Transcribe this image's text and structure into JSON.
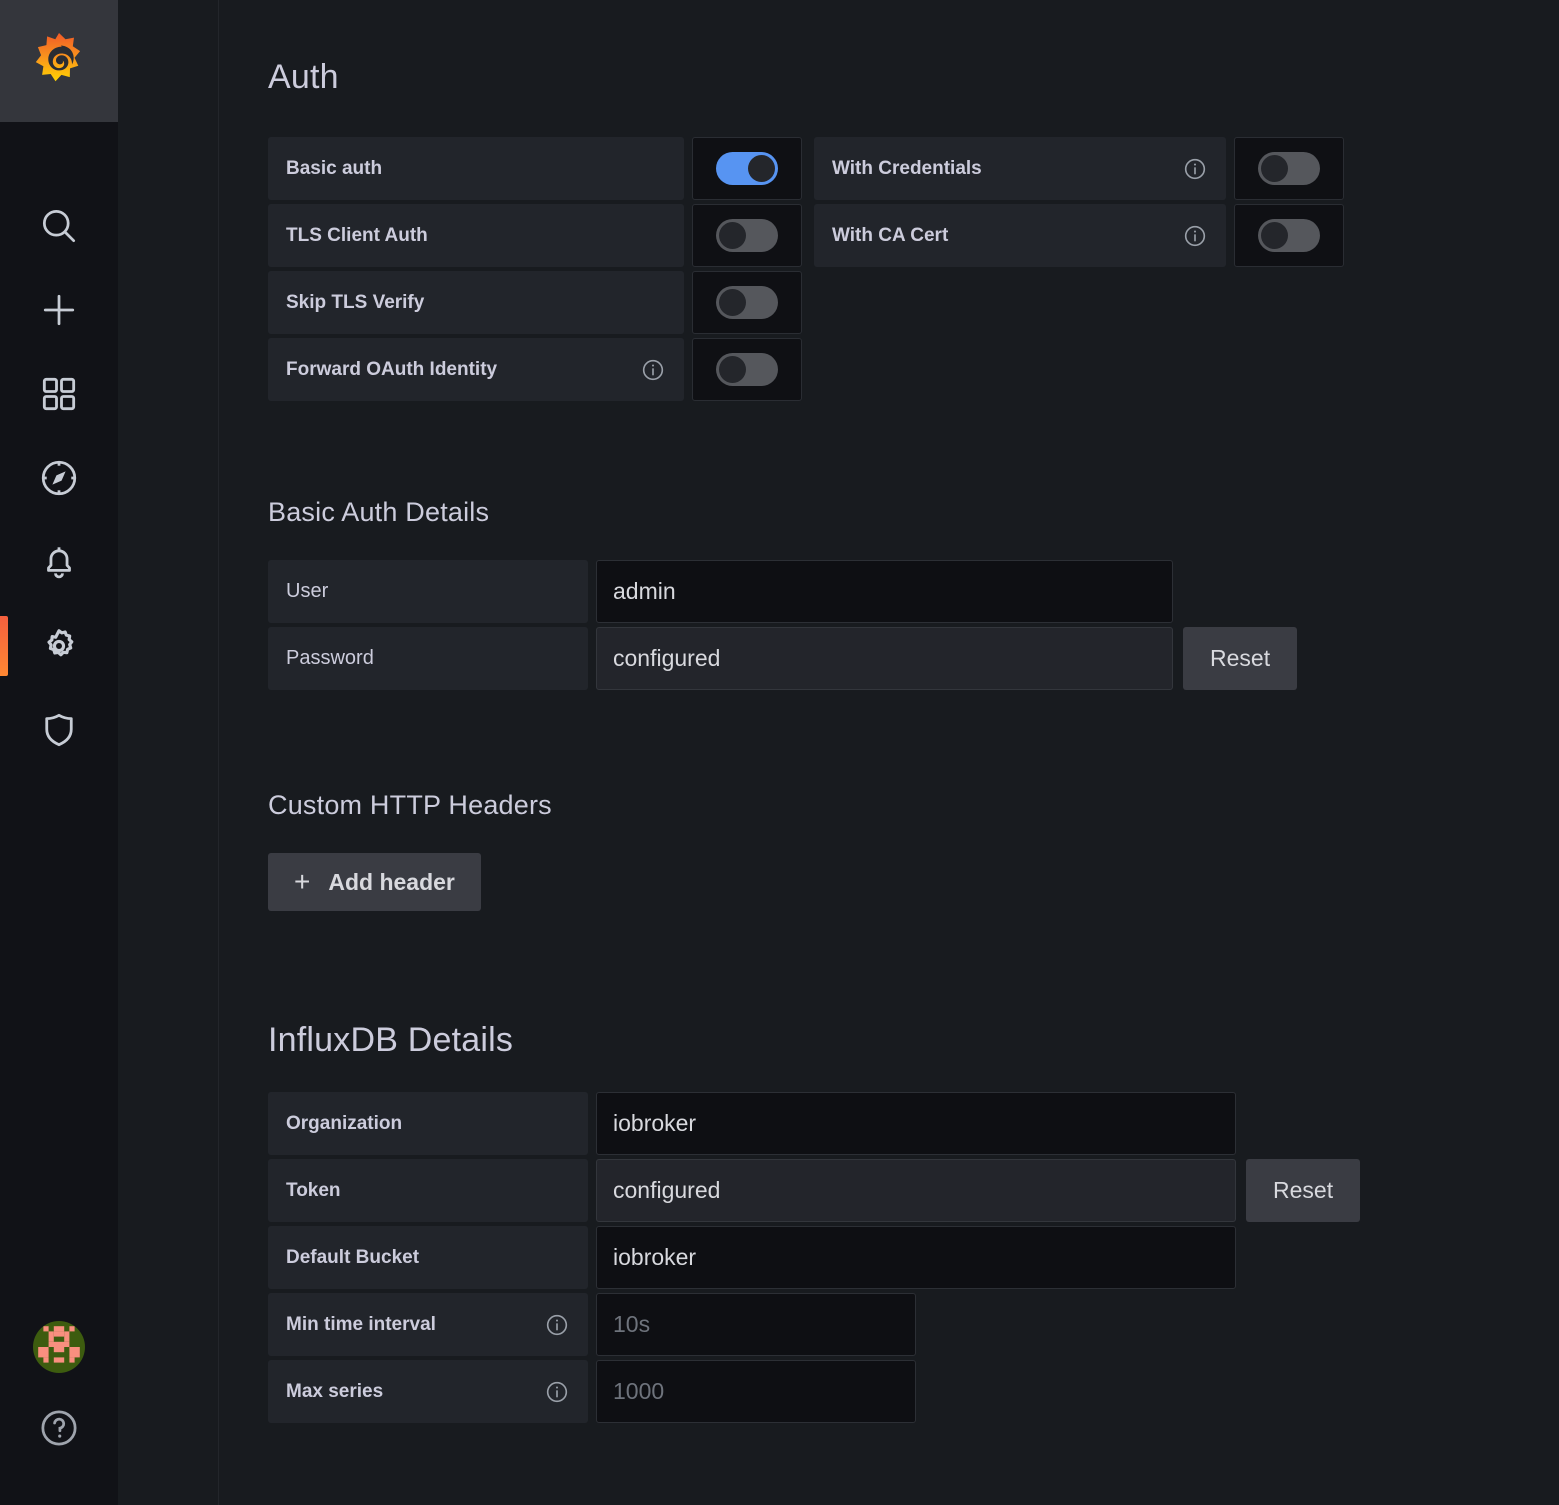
{
  "sidebar": {
    "brand_icon": "grafana-logo",
    "items": [
      {
        "icon": "search-icon",
        "name": "search"
      },
      {
        "icon": "plus-icon",
        "name": "create"
      },
      {
        "icon": "dashboards-icon",
        "name": "dashboards"
      },
      {
        "icon": "compass-icon",
        "name": "explore"
      },
      {
        "icon": "bell-icon",
        "name": "alerting"
      },
      {
        "icon": "gear-icon",
        "name": "configuration",
        "active": true
      },
      {
        "icon": "shield-icon",
        "name": "server-admin"
      }
    ],
    "bottom": [
      {
        "icon": "avatar",
        "name": "user-profile"
      },
      {
        "icon": "help-icon",
        "name": "help"
      }
    ],
    "active_indicator_color": "#f55f3e"
  },
  "auth": {
    "title": "Auth",
    "left_rows": [
      {
        "label": "Basic auth",
        "info": false,
        "on": true
      },
      {
        "label": "TLS Client Auth",
        "info": false,
        "on": false
      },
      {
        "label": "Skip TLS Verify",
        "info": false,
        "on": false
      },
      {
        "label": "Forward OAuth Identity",
        "info": true,
        "on": false
      }
    ],
    "right_rows": [
      {
        "label": "With Credentials",
        "info": true,
        "on": false
      },
      {
        "label": "With CA Cert",
        "info": true,
        "on": false
      }
    ]
  },
  "basic_auth_details": {
    "title": "Basic Auth Details",
    "user": {
      "label": "User",
      "value": "admin",
      "placeholder": ""
    },
    "password": {
      "label": "Password",
      "value": "configured",
      "reset_label": "Reset"
    }
  },
  "custom_http_headers": {
    "title": "Custom HTTP Headers",
    "add_header_label": "Add header",
    "add_header_icon": "plus-icon"
  },
  "influxdb_details": {
    "title": "InfluxDB Details",
    "rows": [
      {
        "label": "Organization",
        "value": "iobroker",
        "info": false,
        "readonly": false,
        "is_placeholder": false,
        "reset": false
      },
      {
        "label": "Token",
        "value": "configured",
        "info": false,
        "readonly": true,
        "is_placeholder": false,
        "reset": true,
        "reset_label": "Reset"
      },
      {
        "label": "Default Bucket",
        "value": "iobroker",
        "info": false,
        "readonly": false,
        "is_placeholder": false,
        "reset": false
      },
      {
        "label": "Min time interval",
        "value": "10s",
        "info": true,
        "readonly": false,
        "is_placeholder": true,
        "reset": false
      },
      {
        "label": "Max series",
        "value": "1000",
        "info": true,
        "readonly": false,
        "is_placeholder": true,
        "reset": false
      }
    ]
  },
  "colors": {
    "page_bg": "#181b1f",
    "sidebar_bg": "#111217",
    "label_bg": "#22252b",
    "input_bg": "#0e0f13",
    "accent_on": "#5794f2",
    "brand_orange": "#f55f3e",
    "text": "#ccccdc"
  }
}
